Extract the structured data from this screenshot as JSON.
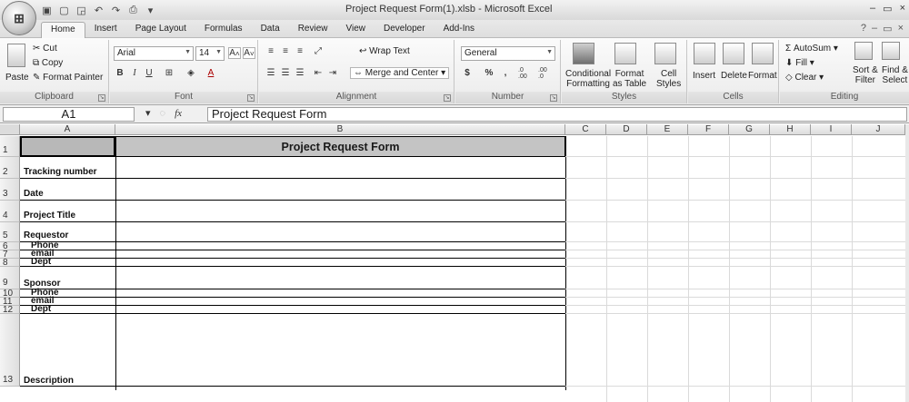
{
  "titlebar": {
    "office_button": "⊞",
    "title": "Project Request Form(1).xlsb - Microsoft Excel",
    "controls": [
      "–",
      "▭",
      "×"
    ]
  },
  "tabs": [
    "Home",
    "Insert",
    "Page Layout",
    "Formulas",
    "Data",
    "Review",
    "View",
    "Developer",
    "Add-Ins"
  ],
  "active_tab": "Home",
  "help_icons": [
    "?",
    "–",
    "▭",
    "×"
  ],
  "ribbon": {
    "clipboard": {
      "paste": "Paste",
      "cut": "Cut",
      "copy": "Copy",
      "format_painter": "Format Painter",
      "label": "Clipboard"
    },
    "font": {
      "name": "Arial",
      "size": "14",
      "bold": "B",
      "italic": "I",
      "underline": "U",
      "label": "Font"
    },
    "alignment": {
      "wrap_text": "Wrap Text",
      "merge_center": "Merge and Center",
      "label": "Alignment"
    },
    "number": {
      "format": "General",
      "currency": "$",
      "percent": "%",
      "comma": ",",
      "inc_dec": ".0 .00",
      "dec_dec": ".00 .0",
      "label": "Number"
    },
    "styles": {
      "conditional": "Conditional",
      "formatting": "Formatting",
      "format": "Format",
      "as_table": "as Table",
      "cell": "Cell",
      "styles_btn": "Styles",
      "label": "Styles"
    },
    "cells": {
      "insert": "Insert",
      "delete": "Delete",
      "format": "Format",
      "label": "Cells"
    },
    "editing": {
      "autosum": "AutoSum",
      "fill": "Fill",
      "clear": "Clear",
      "sort": "Sort &",
      "filter": "Filter",
      "find": "Find &",
      "select": "Select",
      "label": "Editing"
    }
  },
  "formula_bar": {
    "name_box": "A1",
    "fx": "fx",
    "content": "Project Request Form"
  },
  "columns": [
    "A",
    "B",
    "C",
    "D",
    "E",
    "F",
    "G",
    "H",
    "I",
    "J"
  ],
  "rows": [
    "1",
    "2",
    "3",
    "4",
    "5",
    "6",
    "7",
    "8",
    "9",
    "10",
    "11",
    "12",
    "13"
  ],
  "cells": {
    "b1": "Project Request Form",
    "a2": "Tracking number",
    "a3": "Date",
    "a4": "Project Title",
    "a5": "Requestor",
    "a6": "Phone",
    "a7": "email",
    "a8": "Dept",
    "a9": "Sponsor",
    "a10": "Phone",
    "a11": "email",
    "a12": "Dept",
    "a13": "Description"
  }
}
